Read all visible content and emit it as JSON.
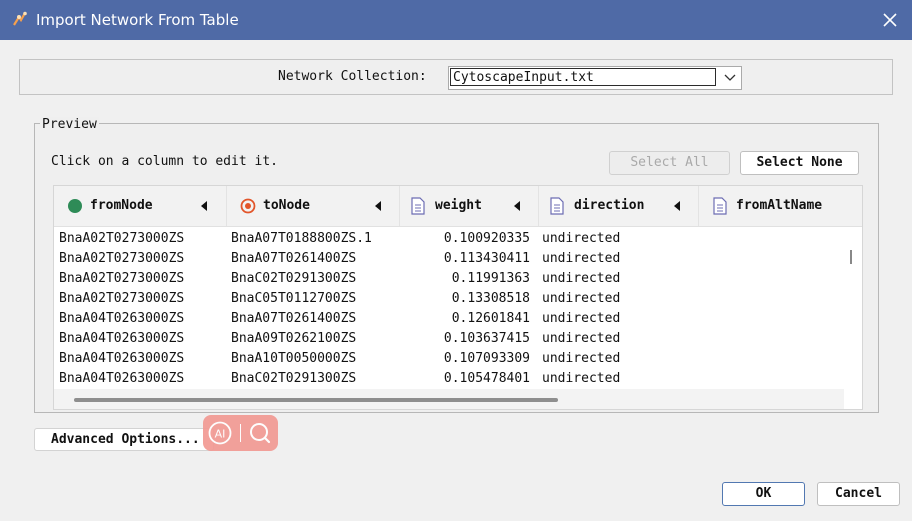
{
  "window": {
    "title": "Import Network From Table",
    "icons": {
      "app": "cytoscape-logo-icon",
      "close": "close-icon"
    }
  },
  "network_collection": {
    "label": "Network Collection:",
    "selected": "CytoscapeInput.txt"
  },
  "preview": {
    "legend": "Preview",
    "hint": "Click on a column to edit it.",
    "select_all_label": "Select All",
    "select_none_label": "Select None",
    "columns": [
      {
        "name": "fromNode",
        "icon": "source-node-icon",
        "icon_color": "#2e8b57"
      },
      {
        "name": "toNode",
        "icon": "target-node-icon",
        "icon_color": "#e2552a"
      },
      {
        "name": "weight",
        "icon": "edge-attribute-icon",
        "icon_color": "#6d6db3"
      },
      {
        "name": "direction",
        "icon": "edge-attribute-icon",
        "icon_color": "#6d6db3"
      },
      {
        "name": "fromAltName",
        "icon": "edge-attribute-icon",
        "icon_color": "#6d6db3"
      }
    ],
    "rows": [
      [
        "BnaA02T0273000ZS",
        "BnaA07T0188800ZS.1",
        "0.100920335",
        "undirected"
      ],
      [
        "BnaA02T0273000ZS",
        "BnaA07T0261400ZS",
        "0.113430411",
        "undirected"
      ],
      [
        "BnaA02T0273000ZS",
        "BnaC02T0291300ZS",
        "0.11991363",
        "undirected"
      ],
      [
        "BnaA02T0273000ZS",
        "BnaC05T0112700ZS",
        "0.13308518",
        "undirected"
      ],
      [
        "BnaA04T0263000ZS",
        "BnaA07T0261400ZS",
        "0.12601841",
        "undirected"
      ],
      [
        "BnaA04T0263000ZS",
        "BnaA09T0262100ZS",
        "0.103637415",
        "undirected"
      ],
      [
        "BnaA04T0263000ZS",
        "BnaA10T0050000ZS",
        "0.107093309",
        "undirected"
      ],
      [
        "BnaA04T0263000ZS",
        "BnaC02T0291300ZS",
        "0.105478401",
        "undirected"
      ]
    ]
  },
  "advanced_options_label": "Advanced Options...",
  "overlay": {
    "ai_label": "AI",
    "icons": [
      "ai-assistant-icon",
      "search-icon"
    ]
  },
  "footer": {
    "ok_label": "OK",
    "cancel_label": "Cancel"
  },
  "colors": {
    "titlebar": "#4f6aa6",
    "accent_border": "#5278b1",
    "overlay": "#f29a93"
  }
}
